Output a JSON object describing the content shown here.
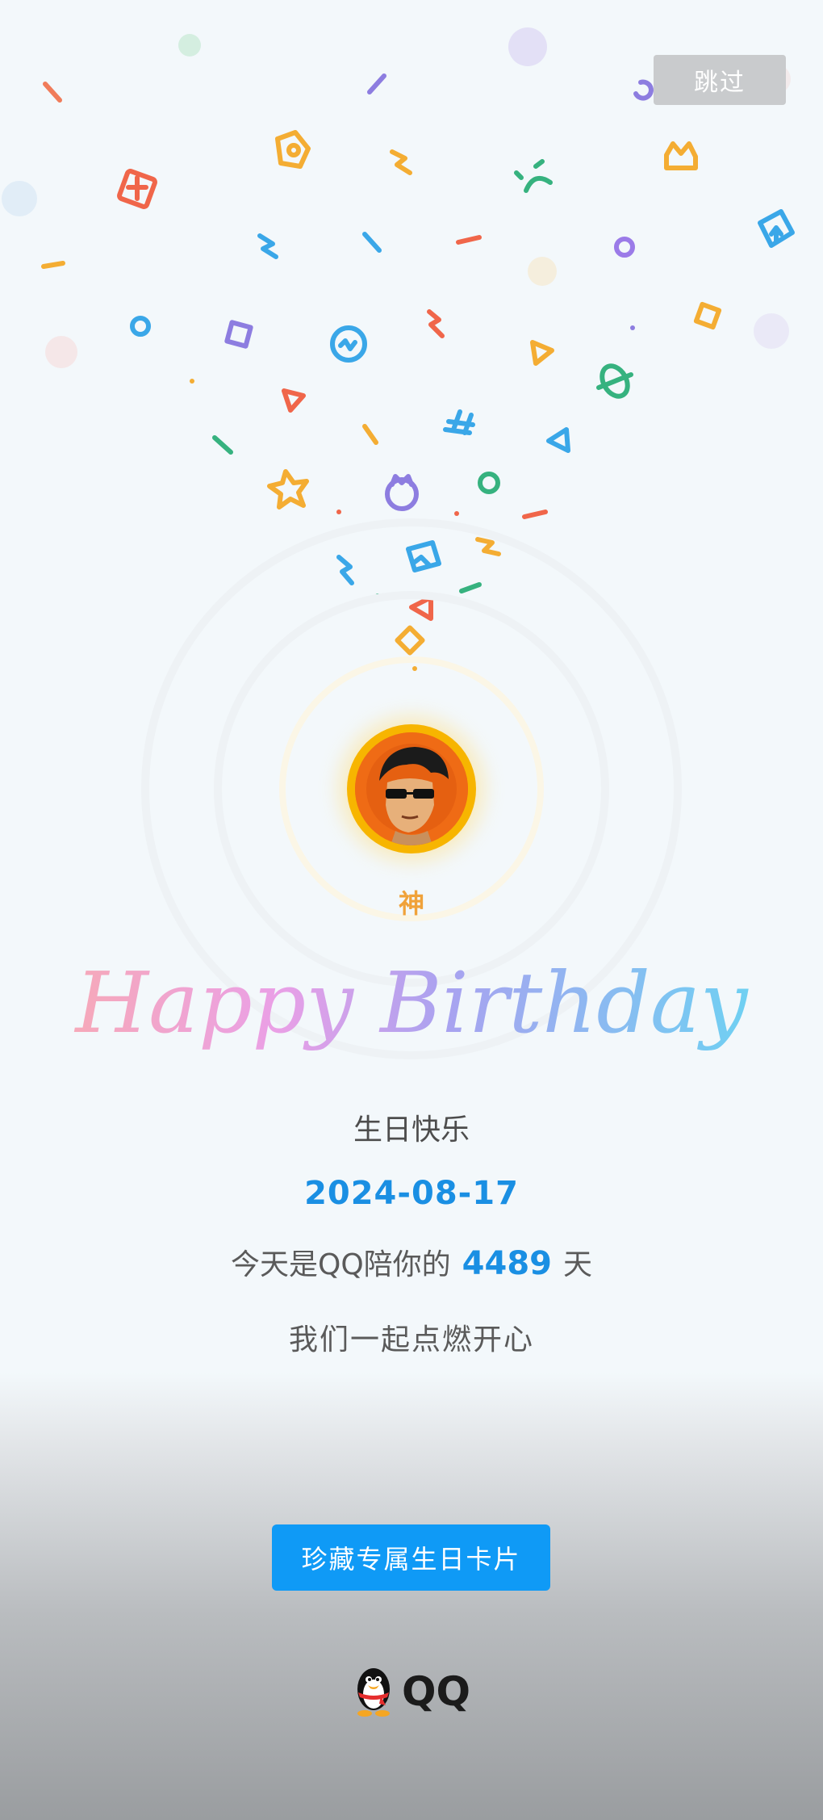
{
  "header": {
    "skip_label": "跳过"
  },
  "profile": {
    "nickname": "神"
  },
  "card": {
    "title": "Happy Birthday",
    "greeting": "生日快乐",
    "date": "2024-08-17",
    "days_prefix": "今天是QQ陪你的",
    "days_count": "4489",
    "days_suffix": "天",
    "slogan": "我们一起点燃开心"
  },
  "actions": {
    "collect_label": "珍藏专属生日卡片"
  },
  "brand": {
    "logo_text": "QQ",
    "logo_icon": "qq-penguin-icon"
  },
  "colors": {
    "accent_blue": "#1a8fe3",
    "button_blue": "#0f9af6",
    "avatar_ring": "#f7b500",
    "nickname": "#f0a23a"
  }
}
